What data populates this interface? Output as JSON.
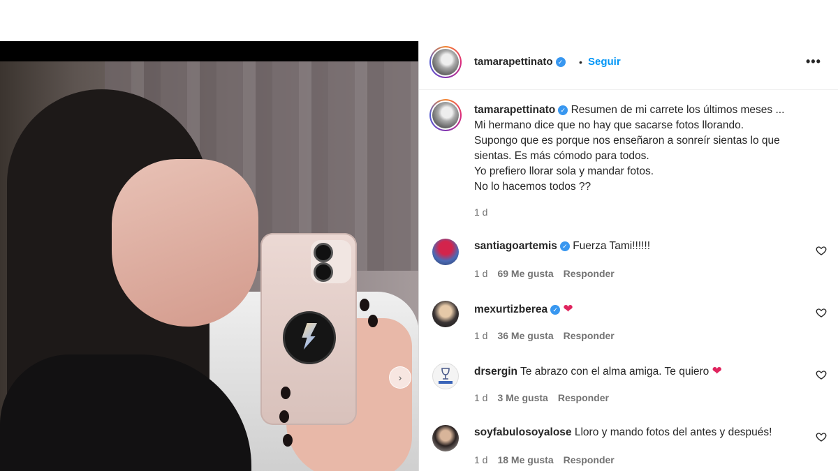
{
  "post": {
    "media": {
      "next_icon": "chevron-right-icon",
      "next_glyph": "›"
    },
    "header": {
      "username": "tamarapettinato",
      "verified_icon": "verified-badge-icon",
      "separator": "•",
      "follow_label": "Seguir",
      "more_icon": "more-horizontal-icon",
      "more_glyph": "•••"
    },
    "caption": {
      "username": "tamarapettinato",
      "lines": [
        "Resumen de mi carrete los últimos meses ...",
        "Mi hermano dice que no hay que sacarse fotos llorando.",
        "Supongo que es porque nos enseñaron a sonreír sientas lo que",
        "sientas. Es más cómodo para todos.",
        "Yo prefiero llorar sola y mandar fotos.",
        "No lo hacemos todos ??"
      ],
      "time": "1 d"
    },
    "comments": [
      {
        "username": "santiagoartemis",
        "verified": true,
        "text": "Fuerza Tami!!!!!!",
        "emoji": "",
        "time": "1 d",
        "likes": "69 Me gusta",
        "reply": "Responder"
      },
      {
        "username": "mexurtizberea",
        "verified": true,
        "text": "",
        "emoji": "❤",
        "time": "1 d",
        "likes": "36 Me gusta",
        "reply": "Responder"
      },
      {
        "username": "drsergin",
        "verified": false,
        "text": "Te abrazo con el alma amiga. Te quiero",
        "emoji": "❤",
        "time": "1 d",
        "likes": "3 Me gusta",
        "reply": "Responder"
      },
      {
        "username": "soyfabulosoyalose",
        "verified": false,
        "text": "Lloro y mando fotos del antes y después!",
        "emoji": "",
        "time": "1 d",
        "likes": "18 Me gusta",
        "reply": "Responder"
      }
    ],
    "like_icon": "heart-outline-icon",
    "colors": {
      "accent": "#0095f6",
      "verified": "#3897f0",
      "muted": "#737373",
      "heart": "#e0245e"
    }
  }
}
